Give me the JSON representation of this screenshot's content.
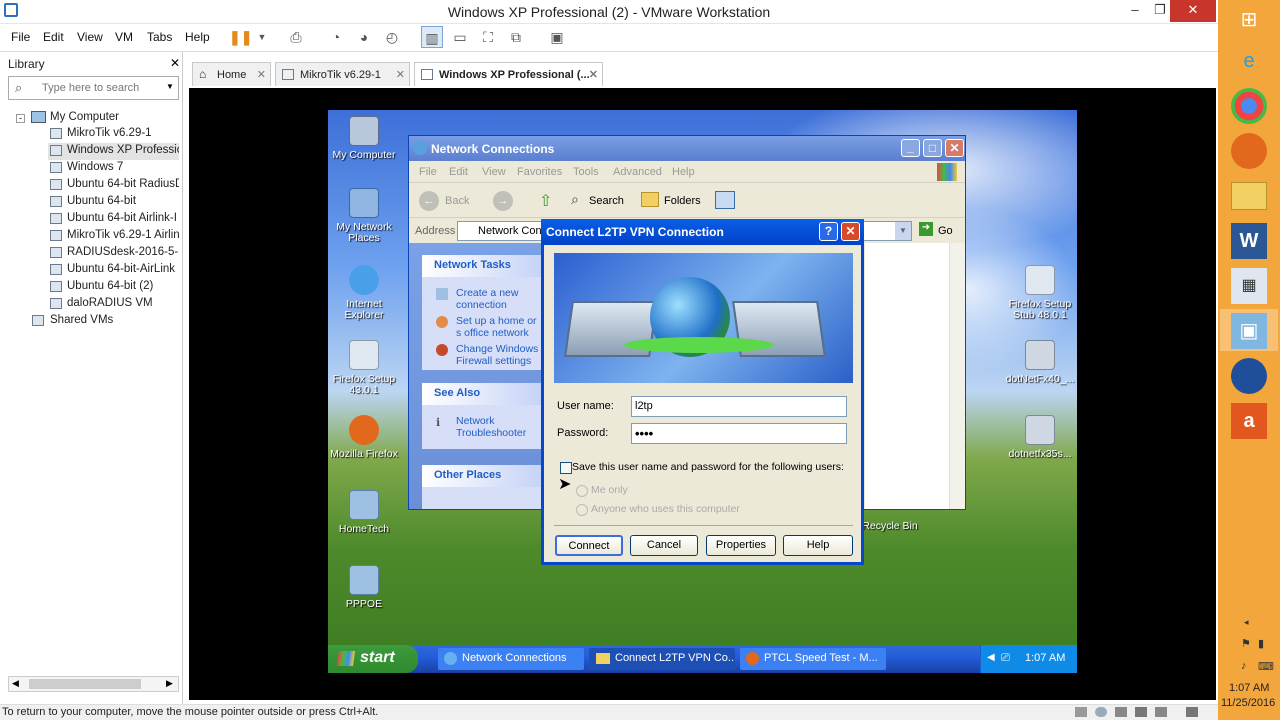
{
  "window": {
    "title": "Windows XP Professional (2) - VMware Workstation",
    "minimize": "–",
    "restore": "❐",
    "close": "✕"
  },
  "menu": [
    "File",
    "Edit",
    "View",
    "VM",
    "Tabs",
    "Help"
  ],
  "library": {
    "title": "Library",
    "search_placeholder": "Type here to search",
    "root": "My Computer",
    "items": [
      "MikroTik v6.29-1",
      "Windows XP Professio",
      "Windows 7",
      "Ubuntu 64-bit RadiusD",
      "Ubuntu 64-bit",
      "Ubuntu 64-bit Airlink-I",
      "MikroTik v6.29-1 Airlin",
      "RADIUSdesk-2016-5-1",
      "Ubuntu 64-bit-AirLink",
      "Ubuntu 64-bit (2)",
      "daloRADIUS VM"
    ],
    "shared": "Shared VMs"
  },
  "tabs": [
    "Home",
    "MikroTik v6.29-1",
    "Windows XP Professional (..."
  ],
  "desktop_icons_left": [
    "My Computer",
    "My Network Places",
    "Internet Explorer",
    "Firefox Setup 43.0.1",
    "Mozilla Firefox",
    "HomeTech",
    "PPPOE"
  ],
  "desktop_icons_right": [
    "Firefox Setup Stub 48.0.1",
    "dotNetFx40_...",
    "dotnetfx35s...",
    "Recycle Bin"
  ],
  "netconn": {
    "title": "Network Connections",
    "menu": [
      "File",
      "Edit",
      "View",
      "Favorites",
      "Tools",
      "Advanced",
      "Help"
    ],
    "back": "Back",
    "search": "Search",
    "folders": "Folders",
    "address_label": "Address",
    "address_value": "Network Conn",
    "go": "Go",
    "tasks_title": "Network Tasks",
    "tasks": [
      "Create a new connection",
      "Set up a home or s office network",
      "Change Windows Firewall settings"
    ],
    "see_also_title": "See Also",
    "see_also": [
      "Network Troubleshooter"
    ],
    "other_places_title": "Other Places"
  },
  "dialog": {
    "title": "Connect L2TP VPN Connection",
    "username_label": "User name:",
    "username_value": "l2tp",
    "password_label": "Password:",
    "password_value": "••••",
    "save_label": "Save this user name and password for the following users:",
    "me_only": "Me only",
    "anyone": "Anyone who uses this computer",
    "buttons": [
      "Connect",
      "Cancel",
      "Properties",
      "Help"
    ]
  },
  "taskbar": {
    "start": "start",
    "items": [
      "Network Connections",
      "Connect L2TP VPN Co...",
      "PTCL Speed Test - M..."
    ],
    "clock": "1:07 AM"
  },
  "win8": {
    "time": "1:07 AM",
    "date": "11/25/2016"
  },
  "status": "To return to your computer, move the mouse pointer outside or press Ctrl+Alt."
}
